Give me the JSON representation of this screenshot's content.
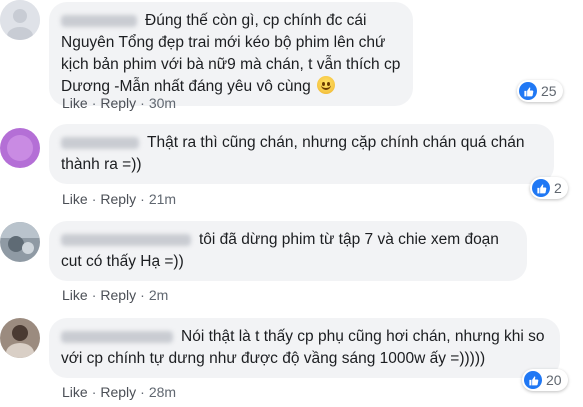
{
  "comments": [
    {
      "text": "Đúng thế còn gì, cp chính đc cái Nguyên Tổng đẹp trai mới kéo bộ phim lên chứ kịch bản phim với bà nữ9 mà chán, t vẫn thích cp Dương -Mẫn nhất đáng yêu vô cùng",
      "like": "Like",
      "reply": "Reply",
      "time": "30m",
      "reactions": "25",
      "avatar_color": "#d8dbe3"
    },
    {
      "text": "Thật ra thì cũng chán, nhưng cặp chính chán quá chán thành ra =))",
      "like": "Like",
      "reply": "Reply",
      "time": "21m",
      "reactions": "2",
      "avatar_color": "#b46fd6"
    },
    {
      "text": "tôi đã dừng phim từ tập 7 và chie xem đoạn cut có thấy Hạ =))",
      "like": "Like",
      "reply": "Reply",
      "time": "2m",
      "reactions": "",
      "avatar_color": "#7d8a96"
    },
    {
      "text": "Nói thật là t thấy cp phụ cũng hơi chán, nhưng khi so với cp chính tự dưng như được độ vầng sáng 1000w ấy =)))))",
      "like": "Like",
      "reply": "Reply",
      "time": "28m",
      "reactions": "20",
      "avatar_color": "#8a7a6e"
    }
  ],
  "colors": {
    "bubble_bg": "#f2f3f5",
    "link": "#4b4f56",
    "like_blue": "#2078f4"
  },
  "icons": [
    "thumbs-up-icon",
    "smile-emoji-icon"
  ]
}
